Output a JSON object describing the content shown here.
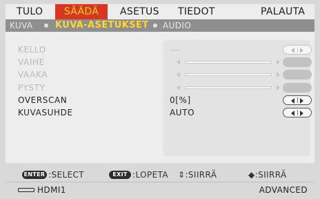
{
  "tabs": [
    {
      "label": "TULO",
      "active": false
    },
    {
      "label": "SÄÄDÄ",
      "active": true
    },
    {
      "label": "ASETUS",
      "active": false
    },
    {
      "label": "TIEDOT",
      "active": false
    },
    {
      "label": "PALAUTA",
      "active": false
    }
  ],
  "subtabs": [
    {
      "label": "KUVA",
      "active": false
    },
    {
      "label": "KUVA-ASETUKSET",
      "active": true
    },
    {
      "label": "AUDIO",
      "active": false
    }
  ],
  "rows": [
    {
      "label": "KELLO",
      "value": "---",
      "control": "arrows",
      "enabled": false
    },
    {
      "label": "VAIHE",
      "value": "",
      "control": "slider",
      "enabled": false
    },
    {
      "label": "VAAKA",
      "value": "",
      "control": "slider",
      "enabled": false
    },
    {
      "label": "PYSTY",
      "value": "",
      "control": "slider",
      "enabled": false
    },
    {
      "label": "OVERSCAN",
      "value": "0[%]",
      "control": "arrows",
      "enabled": true
    },
    {
      "label": "KUVASUHDE",
      "value": "AUTO",
      "control": "arrows",
      "enabled": true
    }
  ],
  "footer": {
    "enter_key": "ENTER",
    "select_text": ":SELECT",
    "exit_key": "EXIT",
    "exit_text": ":LOPETA",
    "updown_text": "⇕:SIIRRÄ",
    "leftright_text": "◆:SIIRRÄ"
  },
  "status": {
    "source_icon": "hdmi-connector-icon",
    "source_label": "HDMI1",
    "mode_label": "ADVANCED"
  },
  "colors": {
    "active_tab_bg": "#d93622",
    "active_text": "#ffd62a",
    "panel_bg": "#ededed",
    "disabled_text": "#b9b9b9"
  }
}
